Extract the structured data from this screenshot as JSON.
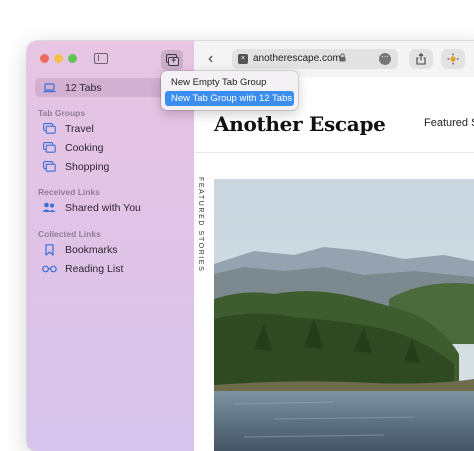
{
  "sidebar": {
    "tabs_item": {
      "label": "12 Tabs"
    },
    "sections": {
      "tab_groups": "Tab Groups",
      "received_links": "Received Links",
      "collected_links": "Collected Links"
    },
    "tab_groups": [
      {
        "label": "Travel",
        "icon": "tab-group-icon"
      },
      {
        "label": "Cooking",
        "icon": "tab-group-icon"
      },
      {
        "label": "Shopping",
        "icon": "tab-group-icon"
      }
    ],
    "received": [
      {
        "label": "Shared with You",
        "icon": "people-icon"
      }
    ],
    "collected": [
      {
        "label": "Bookmarks",
        "icon": "bookmark-icon"
      },
      {
        "label": "Reading List",
        "icon": "glasses-icon"
      }
    ]
  },
  "menu": {
    "items": [
      {
        "label": "New Empty Tab Group",
        "highlighted": false
      },
      {
        "label": "New Tab Group with 12 Tabs",
        "highlighted": true
      }
    ]
  },
  "toolbar": {
    "url": "anotherescape.com"
  },
  "page": {
    "logo": "Another Escape",
    "nav_featured": "Featured S",
    "vertical_label": "Featured Stories"
  },
  "colors": {
    "accent": "#3b8ef0",
    "sidebar": "#e2c4e6"
  }
}
